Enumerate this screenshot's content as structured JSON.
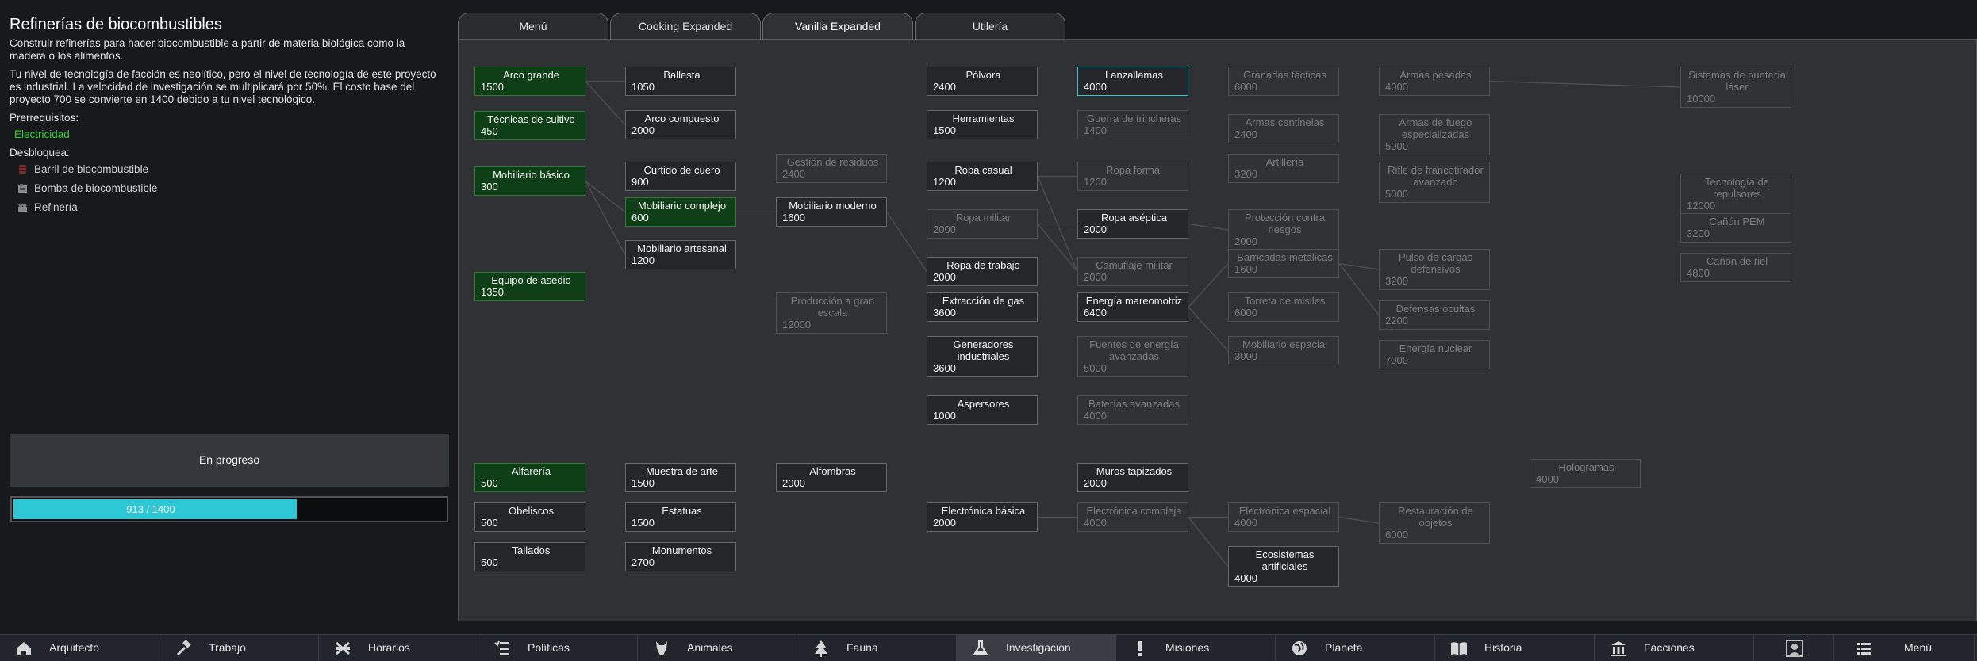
{
  "project": {
    "title": "Refinerías de biocombustibles",
    "description": "Construir refinerías para hacer biocombustible a partir de materia biológica como la madera o los alimentos.",
    "tech_note": "Tu nivel de tecnología de facción es neolítico, pero el nivel de tecnología de este proyecto es industrial. La velocidad de investigación se multiplicará por 50%. El costo base del proyecto 700 se convierte en 1400 debido a tu nivel tecnológico.",
    "prerequisites_label": "Prerrequisitos:",
    "prerequisites": [
      "Electricidad"
    ],
    "unlocks_label": "Desbloquea:",
    "unlocks": [
      {
        "label": "Barril de biocombustible",
        "icon": "barrel-icon"
      },
      {
        "label": "Bomba de biocombustible",
        "icon": "pump-icon"
      },
      {
        "label": "Refinería",
        "icon": "refinery-icon"
      }
    ],
    "status": "En progreso",
    "progress": {
      "current": 913,
      "total": 1400,
      "text": "913 / 1400",
      "fraction": 0.652
    }
  },
  "tabs": [
    {
      "label": "Menú",
      "active": false
    },
    {
      "label": "Cooking Expanded",
      "active": false
    },
    {
      "label": "Vanilla Expanded",
      "active": true
    },
    {
      "label": "Utilería",
      "active": false
    }
  ],
  "nodes": [
    {
      "id": "arco-grande",
      "name": "Arco grande",
      "cost": "1500",
      "state": "done"
    },
    {
      "id": "tecnicas-cultivo",
      "name": "Técnicas de cultivo",
      "cost": "450",
      "state": "done"
    },
    {
      "id": "mobiliario-basico",
      "name": "Mobiliario básico",
      "cost": "300",
      "state": "done"
    },
    {
      "id": "equipo-asedio",
      "name": "Equipo de asedio",
      "cost": "1350",
      "state": "done"
    },
    {
      "id": "alfareria",
      "name": "Alfarería",
      "cost": "500",
      "state": "done"
    },
    {
      "id": "obeliscos",
      "name": "Obeliscos",
      "cost": "500",
      "state": "available"
    },
    {
      "id": "tallados",
      "name": "Tallados",
      "cost": "500",
      "state": "available"
    },
    {
      "id": "ballesta",
      "name": "Ballesta",
      "cost": "1050",
      "state": "available"
    },
    {
      "id": "arco-compuesto",
      "name": "Arco compuesto",
      "cost": "2000",
      "state": "available"
    },
    {
      "id": "curtido-cuero",
      "name": "Curtido de cuero",
      "cost": "900",
      "state": "available"
    },
    {
      "id": "mobiliario-complejo",
      "name": "Mobiliario complejo",
      "cost": "600",
      "state": "done"
    },
    {
      "id": "mobiliario-artesanal",
      "name": "Mobiliario artesanal",
      "cost": "1200",
      "state": "available"
    },
    {
      "id": "muestra-arte",
      "name": "Muestra de arte",
      "cost": "1500",
      "state": "available"
    },
    {
      "id": "estatuas",
      "name": "Estatuas",
      "cost": "1500",
      "state": "available"
    },
    {
      "id": "monumentos",
      "name": "Monumentos",
      "cost": "2700",
      "state": "available"
    },
    {
      "id": "gestion-residuos",
      "name": "Gestión de residuos",
      "cost": "2400",
      "state": "locked"
    },
    {
      "id": "mobiliario-moderno",
      "name": "Mobiliario moderno",
      "cost": "1600",
      "state": "available"
    },
    {
      "id": "produccion-gran-escala",
      "name": "Producción a gran escala",
      "cost": "12000",
      "state": "locked"
    },
    {
      "id": "alfombras",
      "name": "Alfombras",
      "cost": "2000",
      "state": "available"
    },
    {
      "id": "polvora",
      "name": "Pólvora",
      "cost": "2400",
      "state": "available"
    },
    {
      "id": "herramientas",
      "name": "Herramientas",
      "cost": "1500",
      "state": "available"
    },
    {
      "id": "ropa-casual",
      "name": "Ropa casual",
      "cost": "1200",
      "state": "available"
    },
    {
      "id": "ropa-militar",
      "name": "Ropa militar",
      "cost": "2000",
      "state": "locked"
    },
    {
      "id": "ropa-trabajo",
      "name": "Ropa de trabajo",
      "cost": "2000",
      "state": "available"
    },
    {
      "id": "extraccion-gas",
      "name": "Extracción de gas",
      "cost": "3600",
      "state": "available"
    },
    {
      "id": "generadores-industriales",
      "name": "Generadores industriales",
      "cost": "3600",
      "state": "available"
    },
    {
      "id": "aspersores",
      "name": "Aspersores",
      "cost": "1000",
      "state": "available"
    },
    {
      "id": "electronica-basica",
      "name": "Electrónica básica",
      "cost": "2000",
      "state": "available"
    },
    {
      "id": "lanzallamas",
      "name": "Lanzallamas",
      "cost": "4000",
      "state": "selected"
    },
    {
      "id": "guerra-trincheras",
      "name": "Guerra de trincheras",
      "cost": "1400",
      "state": "locked"
    },
    {
      "id": "ropa-formal",
      "name": "Ropa formal",
      "cost": "1200",
      "state": "locked"
    },
    {
      "id": "ropa-aseptica",
      "name": "Ropa aséptica",
      "cost": "2000",
      "state": "available"
    },
    {
      "id": "camuflaje-militar",
      "name": "Camuflaje militar",
      "cost": "2000",
      "state": "locked"
    },
    {
      "id": "energia-mareomotriz",
      "name": "Energía mareomotriz",
      "cost": "6400",
      "state": "available"
    },
    {
      "id": "fuentes-energia-avanzadas",
      "name": "Fuentes de energía avanzadas",
      "cost": "5000",
      "state": "locked"
    },
    {
      "id": "baterias-avanzadas",
      "name": "Baterías avanzadas",
      "cost": "4000",
      "state": "locked"
    },
    {
      "id": "muros-tapizados",
      "name": "Muros tapizados",
      "cost": "2000",
      "state": "available"
    },
    {
      "id": "electronica-compleja",
      "name": "Electrónica compleja",
      "cost": "4000",
      "state": "locked"
    },
    {
      "id": "granadas-tacticas",
      "name": "Granadas tácticas",
      "cost": "6000",
      "state": "locked"
    },
    {
      "id": "armas-centinelas",
      "name": "Armas centinelas",
      "cost": "2400",
      "state": "locked"
    },
    {
      "id": "artilleria",
      "name": "Artillería",
      "cost": "3200",
      "state": "locked"
    },
    {
      "id": "proteccion-riesgos",
      "name": "Protección contra riesgos",
      "cost": "2000",
      "state": "locked"
    },
    {
      "id": "barricadas-metalicas",
      "name": "Barricadas metálicas",
      "cost": "1600",
      "state": "locked"
    },
    {
      "id": "torreta-misiles",
      "name": "Torreta de misiles",
      "cost": "6000",
      "state": "locked"
    },
    {
      "id": "mobiliario-espacial",
      "name": "Mobiliario espacial",
      "cost": "3000",
      "state": "locked"
    },
    {
      "id": "electronica-espacial",
      "name": "Electrónica espacial",
      "cost": "4000",
      "state": "locked"
    },
    {
      "id": "ecosistemas-artificiales",
      "name": "Ecosistemas artificiales",
      "cost": "4000",
      "state": "available"
    },
    {
      "id": "armas-pesadas",
      "name": "Armas pesadas",
      "cost": "4000",
      "state": "locked"
    },
    {
      "id": "armas-fuego-especializadas",
      "name": "Armas de fuego especializadas",
      "cost": "5000",
      "state": "locked"
    },
    {
      "id": "rifle-francotirador",
      "name": "Rifle de francotirador avanzado",
      "cost": "5000",
      "state": "locked"
    },
    {
      "id": "pulso-cargas",
      "name": "Pulso de cargas defensivos",
      "cost": "3200",
      "state": "locked"
    },
    {
      "id": "defensas-ocultas",
      "name": "Defensas ocultas",
      "cost": "2200",
      "state": "locked"
    },
    {
      "id": "energia-nuclear",
      "name": "Energía nuclear",
      "cost": "7000",
      "state": "locked"
    },
    {
      "id": "restauracion-objetos",
      "name": "Restauración de objetos",
      "cost": "6000",
      "state": "locked"
    },
    {
      "id": "hologramas",
      "name": "Hologramas",
      "cost": "4000",
      "state": "locked"
    },
    {
      "id": "sistemas-punteria",
      "name": "Sistemas de puntería láser",
      "cost": "10000",
      "state": "locked"
    },
    {
      "id": "tecnologia-repulsores",
      "name": "Tecnología de repulsores",
      "cost": "12000",
      "state": "locked"
    },
    {
      "id": "canon-pem",
      "name": "Cañón PEM",
      "cost": "3200",
      "state": "locked"
    },
    {
      "id": "canon-riel",
      "name": "Cañón de riel",
      "cost": "4800",
      "state": "locked"
    }
  ],
  "taskbar": [
    {
      "label": "Arquitecto",
      "icon": "house-icon",
      "active": false
    },
    {
      "label": "Trabajo",
      "icon": "hammer-icon",
      "active": false
    },
    {
      "label": "Horarios",
      "icon": "schedule-icon",
      "active": false
    },
    {
      "label": "Políticas",
      "icon": "policy-icon",
      "active": false
    },
    {
      "label": "Animales",
      "icon": "animal-icon",
      "active": false
    },
    {
      "label": "Fauna",
      "icon": "tree-icon",
      "active": false
    },
    {
      "label": "Investigación",
      "icon": "flask-icon",
      "active": true
    },
    {
      "label": "Misiones",
      "icon": "exclamation-icon",
      "active": false
    },
    {
      "label": "Planeta",
      "icon": "globe-icon",
      "active": false
    },
    {
      "label": "Historia",
      "icon": "book-icon",
      "active": false
    },
    {
      "label": "Facciones",
      "icon": "faction-icon",
      "active": false
    },
    {
      "label": "",
      "icon": "portrait-icon",
      "active": false
    },
    {
      "label": "Menú",
      "icon": "menu-icon",
      "active": false
    }
  ]
}
